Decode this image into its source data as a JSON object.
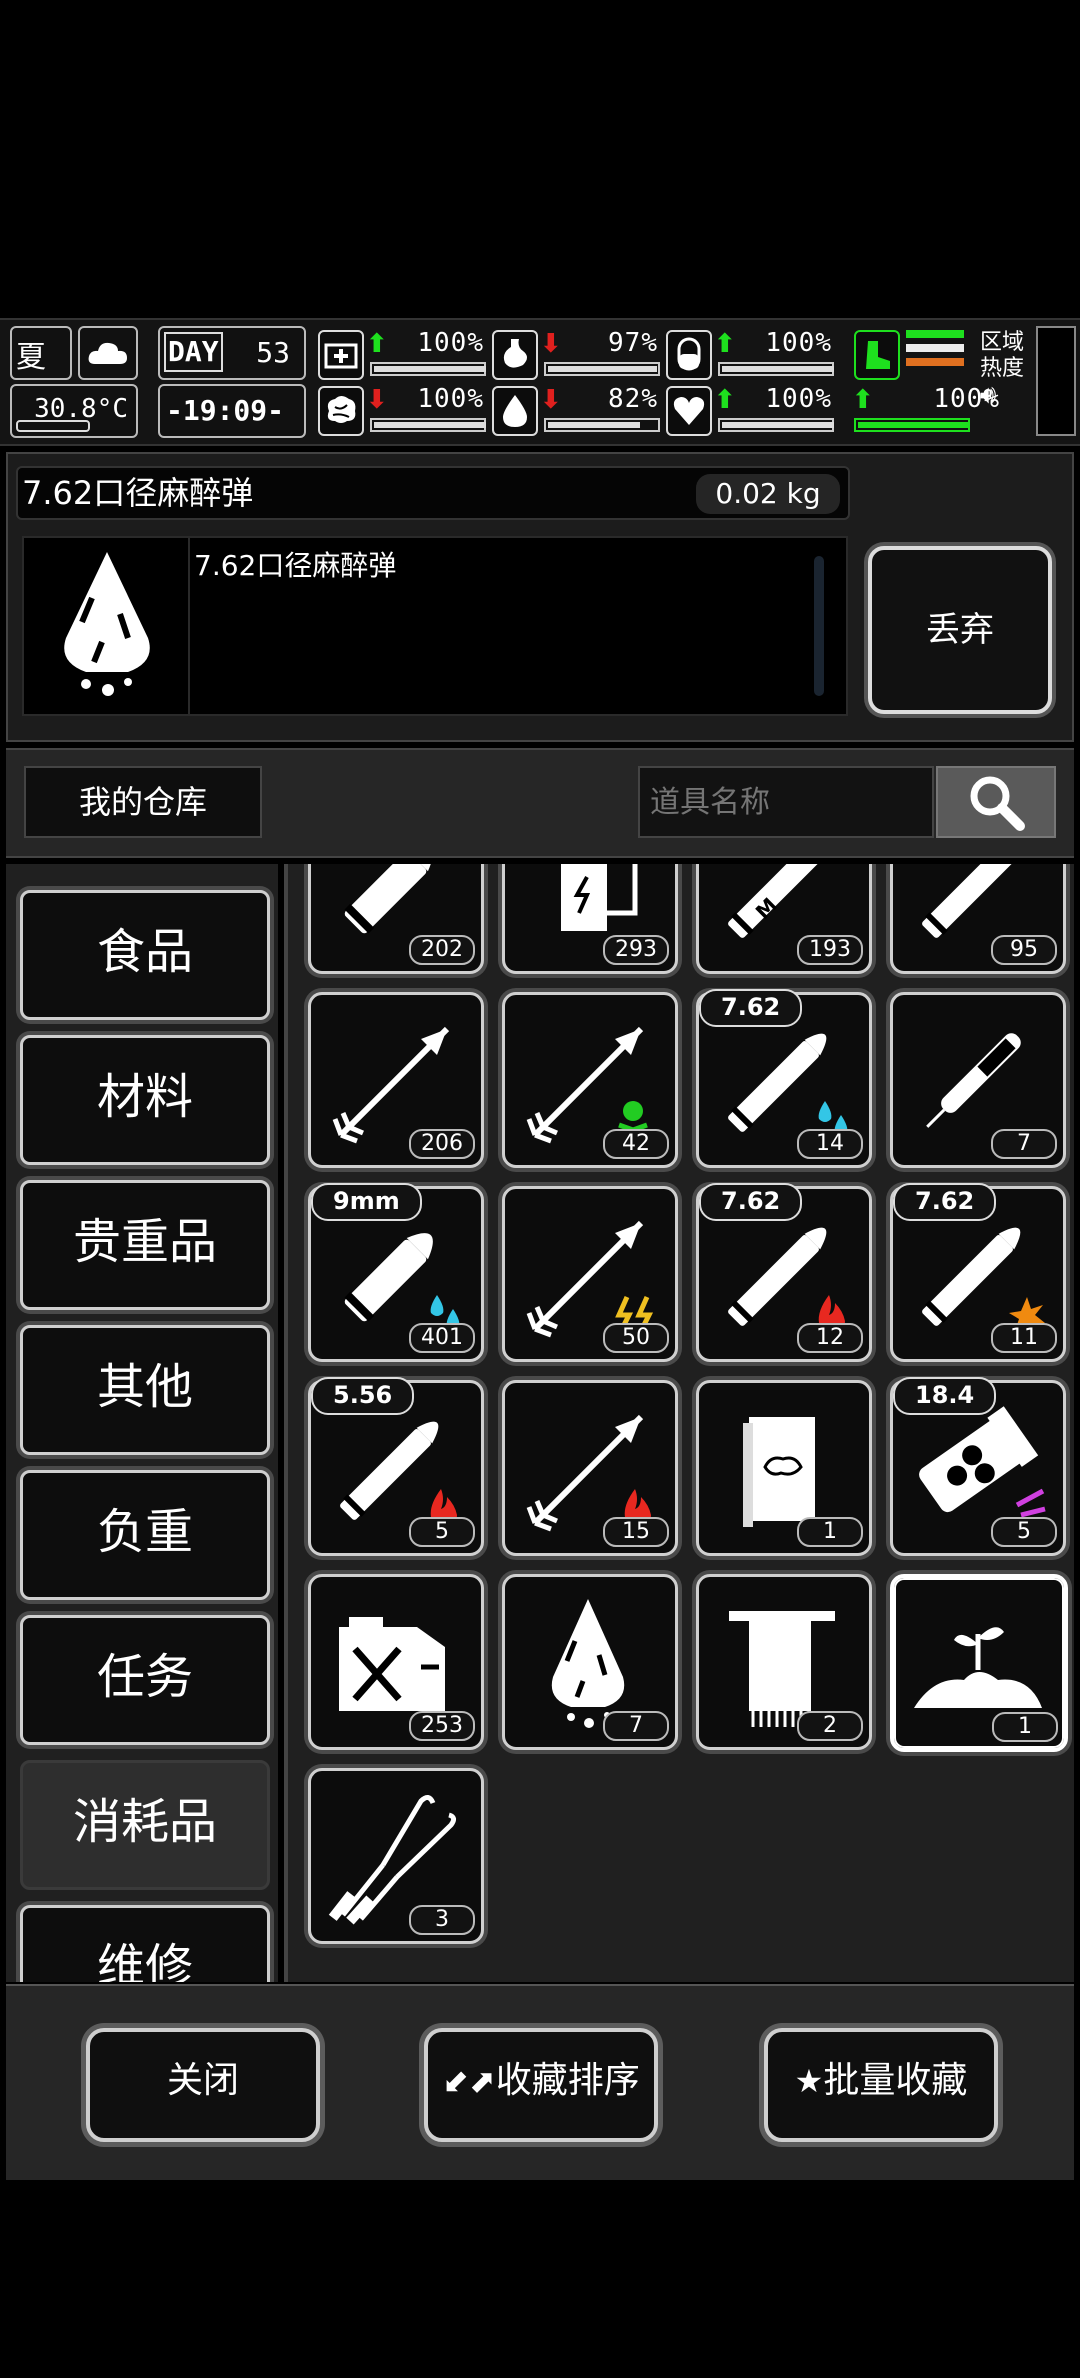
{
  "status": {
    "season": "夏",
    "temperature": "30.8°C",
    "day_label": "DAY",
    "day": "53",
    "time": "-19:09-",
    "stats": [
      {
        "name": "health",
        "icon": "medkit-icon",
        "trend": "up",
        "value": "100%",
        "level": 1.0
      },
      {
        "name": "stomach",
        "icon": "stomach-icon",
        "trend": "down",
        "value": "97%",
        "level": 0.97
      },
      {
        "name": "pill",
        "icon": "pill-icon",
        "trend": "up",
        "value": "100%",
        "level": 1.0
      },
      {
        "name": "brain",
        "icon": "brain-icon",
        "trend": "down",
        "value": "100%",
        "level": 1.0
      },
      {
        "name": "water",
        "icon": "water-drop-icon",
        "trend": "down",
        "value": "82%",
        "level": 0.82
      },
      {
        "name": "heart",
        "icon": "heart-icon",
        "trend": "up",
        "value": "100%",
        "level": 1.0
      }
    ],
    "stamina": {
      "icon": "boot-icon",
      "trend": "up",
      "value": "100%",
      "level": 1.0
    },
    "zone_label_1": "区域",
    "zone_label_2": "热度"
  },
  "item": {
    "name": "7.62口径麻醉弹",
    "weight": "0.02 kg",
    "description": "7.62口径麻醉弹",
    "drop_label": "丢弃"
  },
  "warehouse": {
    "title": "我的仓库",
    "search_placeholder": "道具名称"
  },
  "categories": [
    {
      "label": "食品"
    },
    {
      "label": "材料"
    },
    {
      "label": "贵重品"
    },
    {
      "label": "其他"
    },
    {
      "label": "负重"
    },
    {
      "label": "任务"
    },
    {
      "label": "消耗品",
      "selected": true
    },
    {
      "label": "维修"
    }
  ],
  "items": [
    {
      "icon": "pistol-bullet-icon",
      "count": "202"
    },
    {
      "icon": "battery-icon",
      "count": "293"
    },
    {
      "icon": "rifle-cartridge-m-icon",
      "count": "193"
    },
    {
      "icon": "long-rifle-bullet-icon",
      "count": "95"
    },
    {
      "icon": "arrow-icon",
      "count": "206"
    },
    {
      "icon": "poison-arrow-icon",
      "count": "42"
    },
    {
      "icon": "tranq-rifle-bullet-icon",
      "count": "14",
      "caliber": "7.62"
    },
    {
      "icon": "syringe-pen-icon",
      "count": "7"
    },
    {
      "icon": "tranq-pistol-bullet-icon",
      "count": "401",
      "caliber": "9mm"
    },
    {
      "icon": "electric-arrow-icon",
      "count": "50"
    },
    {
      "icon": "incendiary-rifle-bullet-icon",
      "count": "12",
      "caliber": "7.62"
    },
    {
      "icon": "explosive-rifle-bullet-icon",
      "count": "11",
      "caliber": "7.62"
    },
    {
      "icon": "incendiary-rifle-bullet-icon",
      "count": "5",
      "caliber": "5.56"
    },
    {
      "icon": "fire-arrow-icon",
      "count": "15"
    },
    {
      "icon": "book-icon",
      "count": "1"
    },
    {
      "icon": "shotgun-shell-icon",
      "count": "5",
      "caliber": "18.4"
    },
    {
      "icon": "fuel-can-icon",
      "count": "253"
    },
    {
      "icon": "tranq-powder-icon",
      "count": "7"
    },
    {
      "icon": "towel-icon",
      "count": "2"
    },
    {
      "icon": "soil-sprout-icon",
      "count": "1",
      "selected": true
    },
    {
      "icon": "lockpick-icon",
      "count": "3"
    }
  ],
  "actions": {
    "close": "关闭",
    "sort_favorites": "收藏排序",
    "batch_favorite": "批量收藏"
  },
  "colors": {
    "up_arrow": "#1ee01e",
    "down_arrow": "#e0201e",
    "poison": "#22cc22",
    "water": "#33c6e6",
    "fire": "#e82820",
    "electric": "#f0c020",
    "explosive": "#f08a10",
    "magic": "#d040e0"
  }
}
